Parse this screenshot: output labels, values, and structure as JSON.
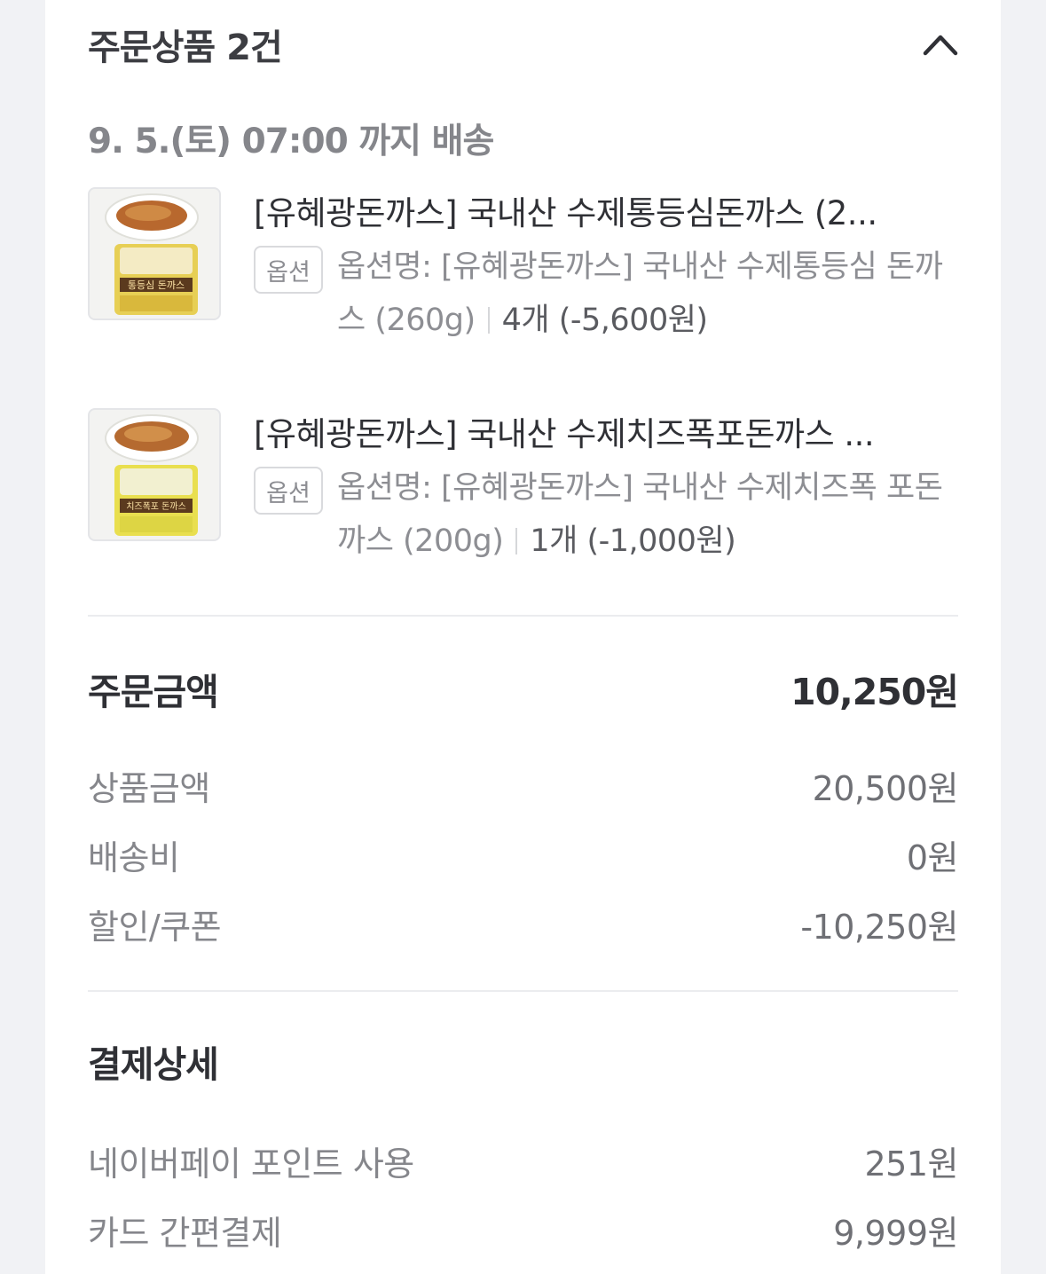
{
  "order_products": {
    "title": "주문상품 2건",
    "delivery": "9. 5.(토) 07:00 까지 배송",
    "items": [
      {
        "name": "[유혜광돈까스] 국내산 수제통등심돈까스 (2...",
        "badge": "옵션",
        "option": "옵션명: [유혜광돈까스] 국내산 수제통등심 돈까스 (260g)",
        "qty": "4개 (-5,600원)",
        "pack_label": "통등심 돈까스"
      },
      {
        "name": "[유혜광돈까스] 국내산 수제치즈폭포돈까스 ...",
        "badge": "옵션",
        "option": "옵션명: [유혜광돈까스] 국내산 수제치즈폭 포돈까스 (200g)",
        "qty": "1개 (-1,000원)",
        "pack_label": "치즈폭포 돈까스"
      }
    ]
  },
  "order_amount": {
    "title": "주문금액",
    "total": "10,250원",
    "rows": [
      {
        "label": "상품금액",
        "value": "20,500원"
      },
      {
        "label": "배송비",
        "value": "0원"
      },
      {
        "label": "할인/쿠폰",
        "value": "-10,250원"
      }
    ]
  },
  "payment": {
    "title": "결제상세",
    "rows": [
      {
        "label": "네이버페이 포인트 사용",
        "value": "251원"
      },
      {
        "label": "카드 간편결제",
        "value": "9,999원"
      }
    ]
  },
  "icons": {
    "collapse": "chevron-up-icon"
  },
  "colors": {
    "background": "#f1f2f5",
    "card": "#ffffff",
    "text": "#2f3035",
    "muted": "#85868b"
  }
}
